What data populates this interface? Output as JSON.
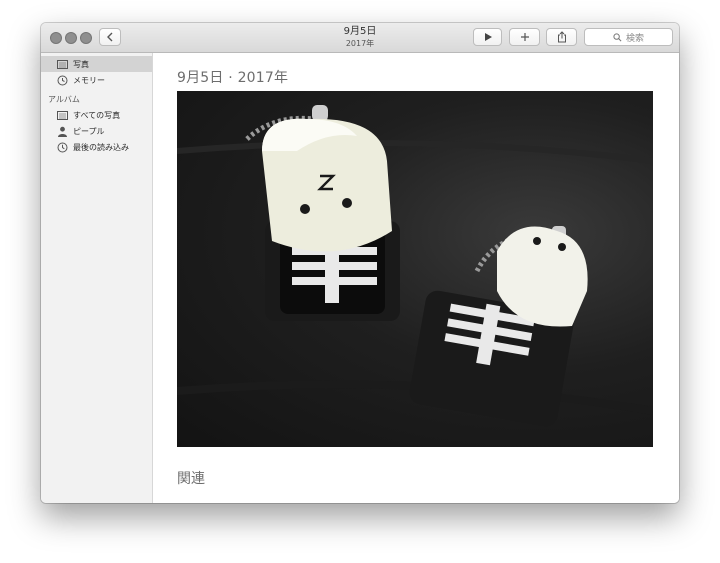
{
  "window": {
    "title": "9月5日",
    "subtitle": "2017年"
  },
  "toolbar": {
    "search_placeholder": "検索",
    "icons": [
      "chevron-left-icon",
      "play-icon",
      "plus-icon",
      "share-icon",
      "search-icon"
    ]
  },
  "sidebar": {
    "items": [
      {
        "label": "写真",
        "icon": "photos-icon",
        "selected": true
      },
      {
        "label": "メモリー",
        "icon": "memories-icon",
        "selected": false
      }
    ],
    "albums_header": "アルバム",
    "albums": [
      {
        "label": "すべての写真",
        "icon": "all-photos-icon"
      },
      {
        "label": "ピープル",
        "icon": "people-icon"
      },
      {
        "label": "最後の読み込み",
        "icon": "clock-icon"
      }
    ]
  },
  "main": {
    "date_heading": "9月5日 · 2017年",
    "related_heading": "関連"
  },
  "colors": {
    "accent_selected": "#d3d3d3",
    "sidebar_bg": "#f2f2f2",
    "heading_text": "#6d6d6d"
  }
}
